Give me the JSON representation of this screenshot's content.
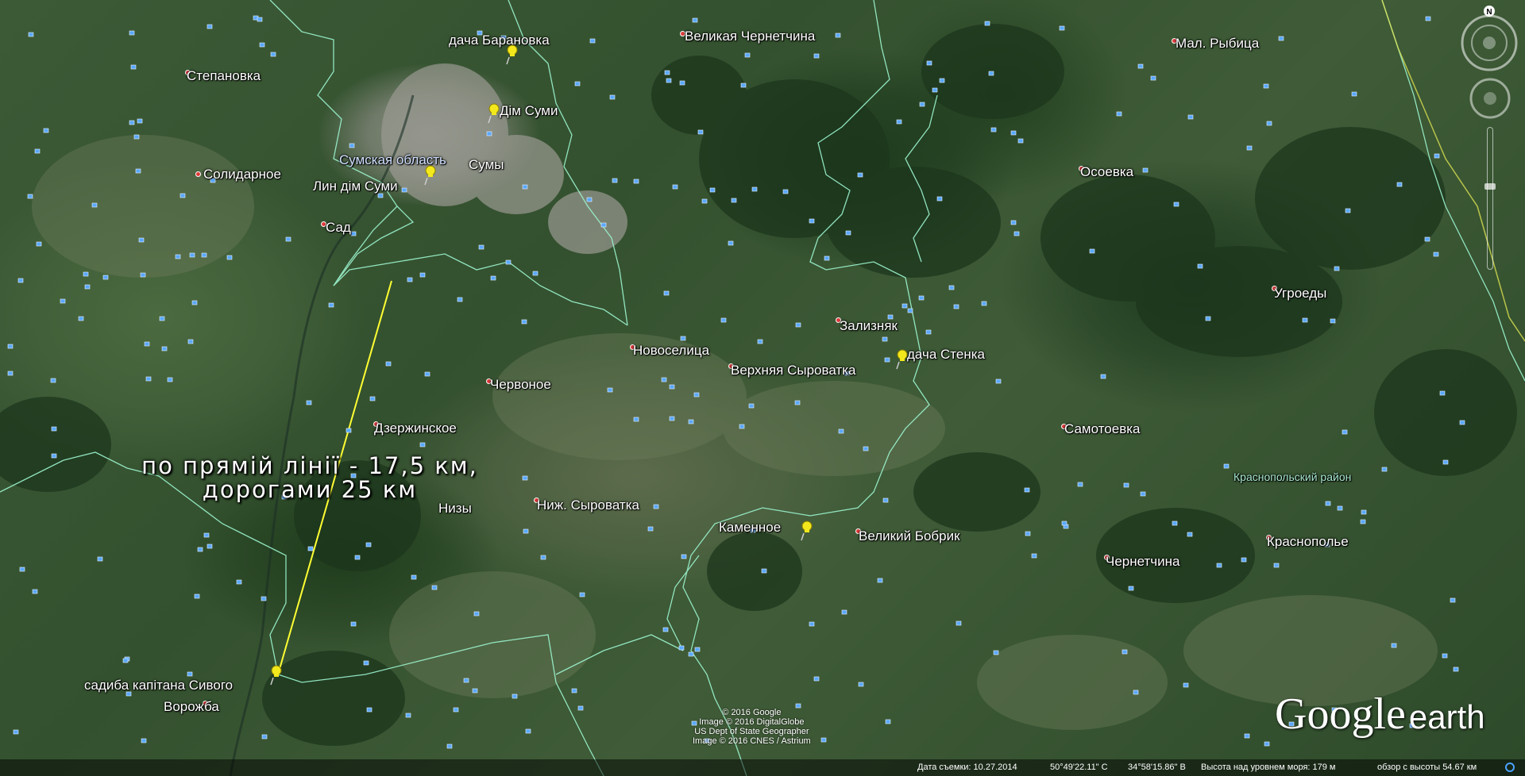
{
  "map": {
    "places": [
      {
        "id": "stepanovka",
        "label": "Степановка",
        "kind": "city"
      },
      {
        "id": "solidarnoe",
        "label": "Солидарное",
        "kind": "city"
      },
      {
        "id": "sad",
        "label": "Сад",
        "kind": "city"
      },
      {
        "id": "dacha-baranovka",
        "label": "дача Барановка",
        "kind": "pin"
      },
      {
        "id": "velikaya-chernetchina",
        "label": "Великая Чернетчина",
        "kind": "city"
      },
      {
        "id": "mal-rybitsa",
        "label": "Мал. Рыбица",
        "kind": "city"
      },
      {
        "id": "dim-sumy",
        "label": "Дім Суми",
        "kind": "pin"
      },
      {
        "id": "sumskaya-oblast",
        "label": "Сумская область",
        "kind": "region"
      },
      {
        "id": "sumy",
        "label": "Сумы",
        "kind": "city"
      },
      {
        "id": "lin-dim-sumy",
        "label": "Лин дім Суми",
        "kind": "pin"
      },
      {
        "id": "osoevka",
        "label": "Осоевка",
        "kind": "city"
      },
      {
        "id": "ugroedy",
        "label": "Угроеды",
        "kind": "city"
      },
      {
        "id": "zaliznyak",
        "label": "Зализняк",
        "kind": "city"
      },
      {
        "id": "dacha-stenka",
        "label": "дача Стенка",
        "kind": "pin"
      },
      {
        "id": "novoselitsa",
        "label": "Новоселица",
        "kind": "city"
      },
      {
        "id": "verkhnyaya-syrovatka",
        "label": "Верхняя Сыроватка",
        "kind": "city"
      },
      {
        "id": "chervonoe",
        "label": "Червоное",
        "kind": "city"
      },
      {
        "id": "dzerzhinskoe",
        "label": "Дзержинское",
        "kind": "city"
      },
      {
        "id": "samotoevka",
        "label": "Самотоевка",
        "kind": "city"
      },
      {
        "id": "krasnopolsky-rayon",
        "label": "Краснопольский район",
        "kind": "district"
      },
      {
        "id": "nizy",
        "label": "Низы",
        "kind": "city"
      },
      {
        "id": "nizh-syrovatka",
        "label": "Ниж. Сыроватка",
        "kind": "city"
      },
      {
        "id": "kamennoe",
        "label": "Каменное",
        "kind": "pin"
      },
      {
        "id": "velikiy-bobrik",
        "label": "Великий Бобрик",
        "kind": "city"
      },
      {
        "id": "krasnopolye",
        "label": "Краснополье",
        "kind": "city"
      },
      {
        "id": "chernetchina",
        "label": "Чернетчина",
        "kind": "city"
      },
      {
        "id": "sadyba",
        "label": "садиба капітана Сивого",
        "kind": "pin"
      },
      {
        "id": "vorozhba",
        "label": "Ворожба",
        "kind": "city"
      }
    ],
    "note": {
      "line1": "по прямій лінії - 17,5 км,",
      "line2": "дорогами 25 км"
    },
    "route_color": "#ffff33",
    "border_color": "#9cf5d0",
    "pin_color": "#f2e81c",
    "credits": [
      "© 2016 Google",
      "Image © 2016 DigitalGlobe",
      "US Dept of State Geographer",
      "Image © 2016 CNES / Astrium"
    ],
    "logo": {
      "google": "Google",
      "earth": "earth"
    },
    "compass_label": "N"
  },
  "status": {
    "date": "Дата съемки: 10.27.2014",
    "lat": "50°49'22.11\" С",
    "lon": "34°58'15.86\" В",
    "elevation": "Высота над уровнем моря:   179 м",
    "eye_alt": "обзор с высоты  54.67 км"
  }
}
